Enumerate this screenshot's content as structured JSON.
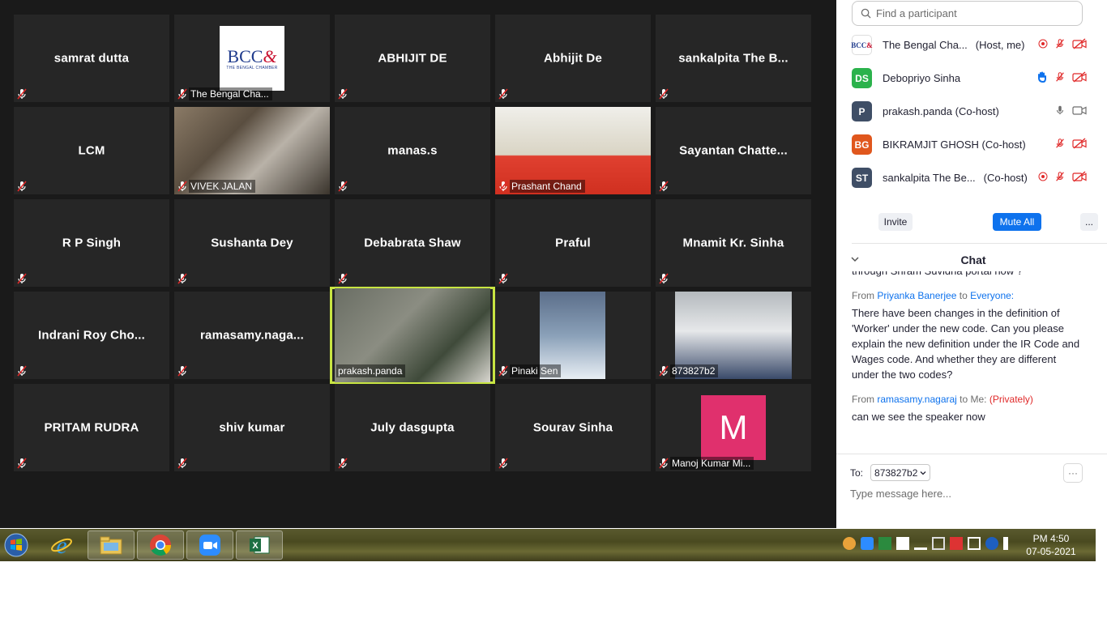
{
  "gallery": {
    "tiles": [
      {
        "name": "samrat dutta"
      },
      {
        "label": "The Bengal Cha..."
      },
      {
        "name": "ABHIJIT DE"
      },
      {
        "name": "Abhijit De"
      },
      {
        "name": "sankalpita The B..."
      },
      {
        "name": "LCM"
      },
      {
        "label": "VIVEK JALAN"
      },
      {
        "name": "manas.s"
      },
      {
        "label": "Prashant Chand"
      },
      {
        "name": "Sayantan  Chatte..."
      },
      {
        "name": "R P Singh"
      },
      {
        "name": "Sushanta Dey"
      },
      {
        "name": "Debabrata Shaw"
      },
      {
        "name": "Praful"
      },
      {
        "name": "Mnamit Kr. Sinha"
      },
      {
        "name": "Indrani Roy Cho..."
      },
      {
        "name": "ramasamy.naga..."
      },
      {
        "label": "prakash.panda"
      },
      {
        "label": "Pinaki Sen"
      },
      {
        "label": "873827b2"
      },
      {
        "name": "PRITAM RUDRA"
      },
      {
        "name": "shiv kumar"
      },
      {
        "name": "July dasgupta"
      },
      {
        "name": "Sourav Sinha"
      },
      {
        "label": "Manoj Kumar Mi...",
        "avatar": "M"
      }
    ],
    "bcc_logo": {
      "mark": "BCC",
      "amp": "&",
      "sub": "THE BENGAL CHAMBER"
    }
  },
  "participants": {
    "search_placeholder": "Find a participant",
    "items": [
      {
        "initials": "",
        "name": "The Bengal Cha...",
        "role": "(Host, me)"
      },
      {
        "initials": "DS",
        "name": "Debopriyo Sinha",
        "role": "",
        "color": "#2bb24c"
      },
      {
        "initials": "P",
        "name": "prakash.panda (Co-host)",
        "role": "",
        "color": "#3f4e66"
      },
      {
        "initials": "BG",
        "name": "BIKRAMJIT GHOSH (Co-host)",
        "role": "",
        "color": "#e0571d"
      },
      {
        "initials": "ST",
        "name": "sankalpita The Be...",
        "role": "(Co-host)",
        "color": "#3f4e66"
      }
    ],
    "invite_label": "Invite",
    "mute_all_label": "Mute All",
    "more_label": "..."
  },
  "chat": {
    "title": "Chat",
    "clipped_line": "through Shram Suvidha portal now ?",
    "messages": [
      {
        "from_label": "From",
        "sender": "Priyanka Banerjee",
        "to_label": "to",
        "recipient": "Everyone:",
        "private": "",
        "text": "There have been changes in the definition of 'Worker' under the new code. Can you please explain the new definition under the IR Code and Wages code. And whether they are different under the two codes?"
      },
      {
        "from_label": "From",
        "sender": "ramasamy.nagaraj",
        "to_label": "to Me:",
        "recipient": "",
        "private": "(Privately)",
        "text": "can we see the speaker now"
      }
    ],
    "to_label": "To:",
    "to_value": "873827b2",
    "more_label": "···",
    "input_placeholder": "Type message here..."
  },
  "taskbar": {
    "time": "PM 4:50",
    "date": "07-05-2021"
  }
}
